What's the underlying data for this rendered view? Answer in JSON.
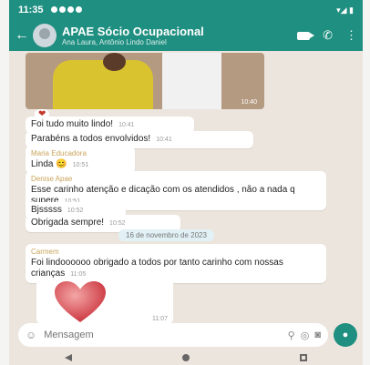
{
  "status_bar": {
    "time": "11:35",
    "right_text": "▾◢ ▮"
  },
  "header": {
    "title": "APAE Sócio Ocupacional",
    "subtitle": "Ana Laura, Antônio Lindo Daniel"
  },
  "messages": [
    {
      "sender": "",
      "text": "Foi tudo muito lindo!",
      "time": "10:41"
    },
    {
      "sender": "",
      "text": "Parabéns a todos envolvidos!",
      "time": "10:41"
    },
    {
      "sender": "Maria Educadora",
      "text": "Linda 😊",
      "time": "10:51"
    },
    {
      "sender": "Denise Apae",
      "text": "Esse carinho atenção e dicação com os atendidos , não a nada q supere",
      "time": "10:51"
    },
    {
      "sender": "",
      "text": "Bjsssss",
      "time": "10:52"
    },
    {
      "sender": "",
      "text": "Obrigada sempre!",
      "time": "10:52"
    },
    {
      "sender": "Carmem",
      "text": "Foi lindoooooo obrigado a todos por tanto carinho com nossas crianças",
      "time": "11:05"
    }
  ],
  "photo_time": "10:40",
  "date_chip": "16 de novembro de 2023",
  "heart_time": "11:07",
  "composer": {
    "placeholder": "Mensagem"
  },
  "colors": {
    "brand": "#1e8f80",
    "chat_bg": "#ece5dd"
  }
}
